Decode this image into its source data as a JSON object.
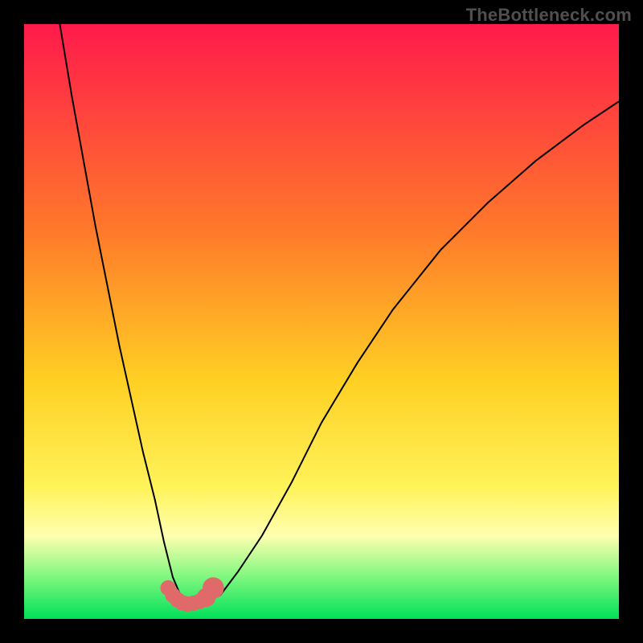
{
  "watermark": "TheBottleneck.com",
  "colors": {
    "frame": "#000000",
    "grad_top": "#ff1a4c",
    "grad_mid1": "#ff7a2a",
    "grad_mid2": "#ffd024",
    "grad_mid3": "#fff35a",
    "grad_band_pale": "#ffffb0",
    "grad_green_lt": "#7ef77e",
    "grad_green": "#00e05a",
    "curve": "#000000",
    "marker": "#e06a6a"
  },
  "chart_data": {
    "type": "line",
    "title": "",
    "xlabel": "",
    "ylabel": "",
    "xlim": [
      0,
      100
    ],
    "ylim": [
      0,
      100
    ],
    "series": [
      {
        "name": "bottleneck-curve",
        "x": [
          6,
          8,
          10,
          12,
          14,
          16,
          18,
          20,
          22,
          23.5,
          25,
          26.5,
          28,
          30,
          33,
          36,
          40,
          45,
          50,
          56,
          62,
          70,
          78,
          86,
          94,
          100
        ],
        "y": [
          100,
          88,
          77,
          66,
          56,
          46,
          37,
          28,
          20,
          13,
          7,
          3.5,
          2.5,
          2.5,
          4,
          8,
          14,
          23,
          33,
          43,
          52,
          62,
          70,
          77,
          83,
          87
        ]
      }
    ],
    "markers": {
      "name": "highlight-points",
      "x": [
        24.2,
        25.0,
        25.8,
        26.6,
        27.4,
        28.4,
        29.4,
        30.6,
        31.8
      ],
      "y": [
        5.2,
        4.0,
        3.2,
        2.7,
        2.5,
        2.6,
        2.9,
        3.6,
        5.2
      ],
      "r": [
        1.3,
        1.3,
        1.3,
        1.3,
        1.3,
        1.3,
        1.3,
        1.6,
        1.8
      ]
    }
  }
}
